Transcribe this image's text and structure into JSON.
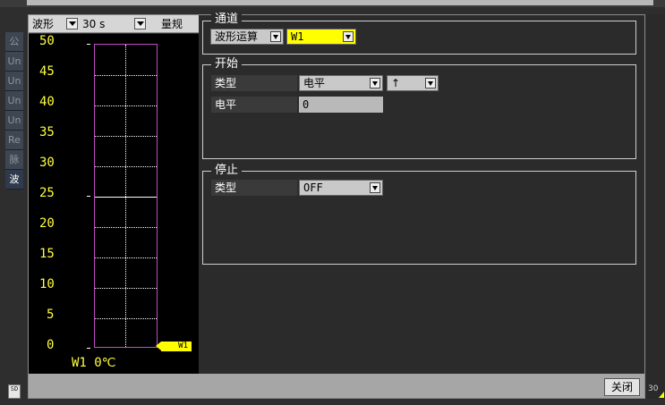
{
  "toolbar": {
    "mode_label": "波形",
    "time_value": "30 s",
    "quantity_label": "量规"
  },
  "left_tabs": [
    {
      "label": "公",
      "active": false
    },
    {
      "label": "Un",
      "active": false
    },
    {
      "label": "Un",
      "active": false
    },
    {
      "label": "Un",
      "active": false
    },
    {
      "label": "Un",
      "active": false
    },
    {
      "label": "Re",
      "active": false
    },
    {
      "label": "脉",
      "active": false
    },
    {
      "label": "波",
      "active": true
    }
  ],
  "graph": {
    "y_ticks": [
      "50",
      "45",
      "40",
      "35",
      "30",
      "25",
      "20",
      "15",
      "10",
      "5",
      "0"
    ],
    "marker_label": "W1",
    "status": "W1 0℃",
    "line_color": "#c14bc1",
    "text_color": "#ffff40"
  },
  "channel": {
    "title": "通道",
    "type_value": "波形运算",
    "channel_value": "W1"
  },
  "start": {
    "title": "开始",
    "type_label": "类型",
    "type_value": "电平",
    "direction_value": "↑",
    "level_label": "电平",
    "level_value": "0"
  },
  "stop": {
    "title": "停止",
    "type_label": "类型",
    "type_value": "OFF"
  },
  "footer": {
    "close_label": "关闭",
    "sd_label": "SD"
  },
  "corner": {
    "badge": "30"
  }
}
